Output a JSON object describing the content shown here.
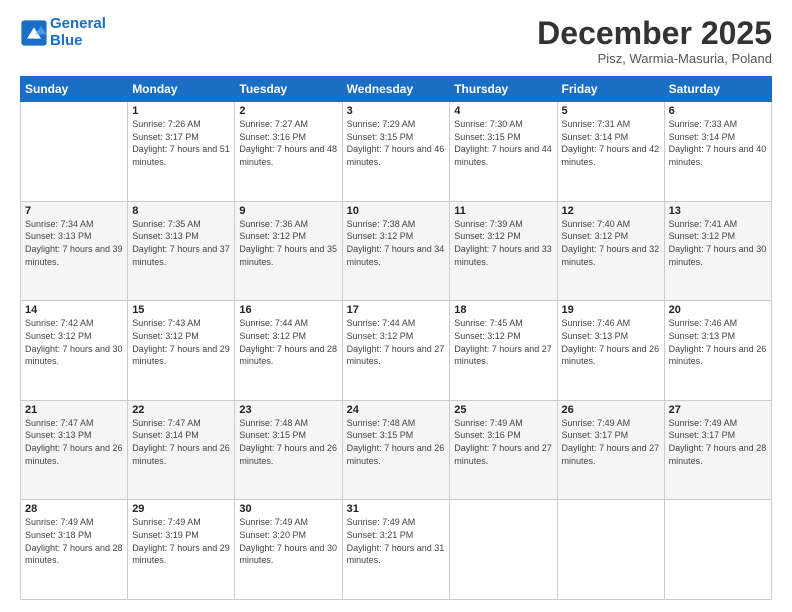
{
  "logo": {
    "line1": "General",
    "line2": "Blue"
  },
  "title": "December 2025",
  "subtitle": "Pisz, Warmia-Masuria, Poland",
  "weekdays": [
    "Sunday",
    "Monday",
    "Tuesday",
    "Wednesday",
    "Thursday",
    "Friday",
    "Saturday"
  ],
  "weeks": [
    [
      {
        "day": "",
        "sunrise": "",
        "sunset": "",
        "daylight": ""
      },
      {
        "day": "1",
        "sunrise": "Sunrise: 7:26 AM",
        "sunset": "Sunset: 3:17 PM",
        "daylight": "Daylight: 7 hours and 51 minutes."
      },
      {
        "day": "2",
        "sunrise": "Sunrise: 7:27 AM",
        "sunset": "Sunset: 3:16 PM",
        "daylight": "Daylight: 7 hours and 48 minutes."
      },
      {
        "day": "3",
        "sunrise": "Sunrise: 7:29 AM",
        "sunset": "Sunset: 3:15 PM",
        "daylight": "Daylight: 7 hours and 46 minutes."
      },
      {
        "day": "4",
        "sunrise": "Sunrise: 7:30 AM",
        "sunset": "Sunset: 3:15 PM",
        "daylight": "Daylight: 7 hours and 44 minutes."
      },
      {
        "day": "5",
        "sunrise": "Sunrise: 7:31 AM",
        "sunset": "Sunset: 3:14 PM",
        "daylight": "Daylight: 7 hours and 42 minutes."
      },
      {
        "day": "6",
        "sunrise": "Sunrise: 7:33 AM",
        "sunset": "Sunset: 3:14 PM",
        "daylight": "Daylight: 7 hours and 40 minutes."
      }
    ],
    [
      {
        "day": "7",
        "sunrise": "Sunrise: 7:34 AM",
        "sunset": "Sunset: 3:13 PM",
        "daylight": "Daylight: 7 hours and 39 minutes."
      },
      {
        "day": "8",
        "sunrise": "Sunrise: 7:35 AM",
        "sunset": "Sunset: 3:13 PM",
        "daylight": "Daylight: 7 hours and 37 minutes."
      },
      {
        "day": "9",
        "sunrise": "Sunrise: 7:36 AM",
        "sunset": "Sunset: 3:12 PM",
        "daylight": "Daylight: 7 hours and 35 minutes."
      },
      {
        "day": "10",
        "sunrise": "Sunrise: 7:38 AM",
        "sunset": "Sunset: 3:12 PM",
        "daylight": "Daylight: 7 hours and 34 minutes."
      },
      {
        "day": "11",
        "sunrise": "Sunrise: 7:39 AM",
        "sunset": "Sunset: 3:12 PM",
        "daylight": "Daylight: 7 hours and 33 minutes."
      },
      {
        "day": "12",
        "sunrise": "Sunrise: 7:40 AM",
        "sunset": "Sunset: 3:12 PM",
        "daylight": "Daylight: 7 hours and 32 minutes."
      },
      {
        "day": "13",
        "sunrise": "Sunrise: 7:41 AM",
        "sunset": "Sunset: 3:12 PM",
        "daylight": "Daylight: 7 hours and 30 minutes."
      }
    ],
    [
      {
        "day": "14",
        "sunrise": "Sunrise: 7:42 AM",
        "sunset": "Sunset: 3:12 PM",
        "daylight": "Daylight: 7 hours and 30 minutes."
      },
      {
        "day": "15",
        "sunrise": "Sunrise: 7:43 AM",
        "sunset": "Sunset: 3:12 PM",
        "daylight": "Daylight: 7 hours and 29 minutes."
      },
      {
        "day": "16",
        "sunrise": "Sunrise: 7:44 AM",
        "sunset": "Sunset: 3:12 PM",
        "daylight": "Daylight: 7 hours and 28 minutes."
      },
      {
        "day": "17",
        "sunrise": "Sunrise: 7:44 AM",
        "sunset": "Sunset: 3:12 PM",
        "daylight": "Daylight: 7 hours and 27 minutes."
      },
      {
        "day": "18",
        "sunrise": "Sunrise: 7:45 AM",
        "sunset": "Sunset: 3:12 PM",
        "daylight": "Daylight: 7 hours and 27 minutes."
      },
      {
        "day": "19",
        "sunrise": "Sunrise: 7:46 AM",
        "sunset": "Sunset: 3:13 PM",
        "daylight": "Daylight: 7 hours and 26 minutes."
      },
      {
        "day": "20",
        "sunrise": "Sunrise: 7:46 AM",
        "sunset": "Sunset: 3:13 PM",
        "daylight": "Daylight: 7 hours and 26 minutes."
      }
    ],
    [
      {
        "day": "21",
        "sunrise": "Sunrise: 7:47 AM",
        "sunset": "Sunset: 3:13 PM",
        "daylight": "Daylight: 7 hours and 26 minutes."
      },
      {
        "day": "22",
        "sunrise": "Sunrise: 7:47 AM",
        "sunset": "Sunset: 3:14 PM",
        "daylight": "Daylight: 7 hours and 26 minutes."
      },
      {
        "day": "23",
        "sunrise": "Sunrise: 7:48 AM",
        "sunset": "Sunset: 3:15 PM",
        "daylight": "Daylight: 7 hours and 26 minutes."
      },
      {
        "day": "24",
        "sunrise": "Sunrise: 7:48 AM",
        "sunset": "Sunset: 3:15 PM",
        "daylight": "Daylight: 7 hours and 26 minutes."
      },
      {
        "day": "25",
        "sunrise": "Sunrise: 7:49 AM",
        "sunset": "Sunset: 3:16 PM",
        "daylight": "Daylight: 7 hours and 27 minutes."
      },
      {
        "day": "26",
        "sunrise": "Sunrise: 7:49 AM",
        "sunset": "Sunset: 3:17 PM",
        "daylight": "Daylight: 7 hours and 27 minutes."
      },
      {
        "day": "27",
        "sunrise": "Sunrise: 7:49 AM",
        "sunset": "Sunset: 3:17 PM",
        "daylight": "Daylight: 7 hours and 28 minutes."
      }
    ],
    [
      {
        "day": "28",
        "sunrise": "Sunrise: 7:49 AM",
        "sunset": "Sunset: 3:18 PM",
        "daylight": "Daylight: 7 hours and 28 minutes."
      },
      {
        "day": "29",
        "sunrise": "Sunrise: 7:49 AM",
        "sunset": "Sunset: 3:19 PM",
        "daylight": "Daylight: 7 hours and 29 minutes."
      },
      {
        "day": "30",
        "sunrise": "Sunrise: 7:49 AM",
        "sunset": "Sunset: 3:20 PM",
        "daylight": "Daylight: 7 hours and 30 minutes."
      },
      {
        "day": "31",
        "sunrise": "Sunrise: 7:49 AM",
        "sunset": "Sunset: 3:21 PM",
        "daylight": "Daylight: 7 hours and 31 minutes."
      },
      {
        "day": "",
        "sunrise": "",
        "sunset": "",
        "daylight": ""
      },
      {
        "day": "",
        "sunrise": "",
        "sunset": "",
        "daylight": ""
      },
      {
        "day": "",
        "sunrise": "",
        "sunset": "",
        "daylight": ""
      }
    ]
  ]
}
